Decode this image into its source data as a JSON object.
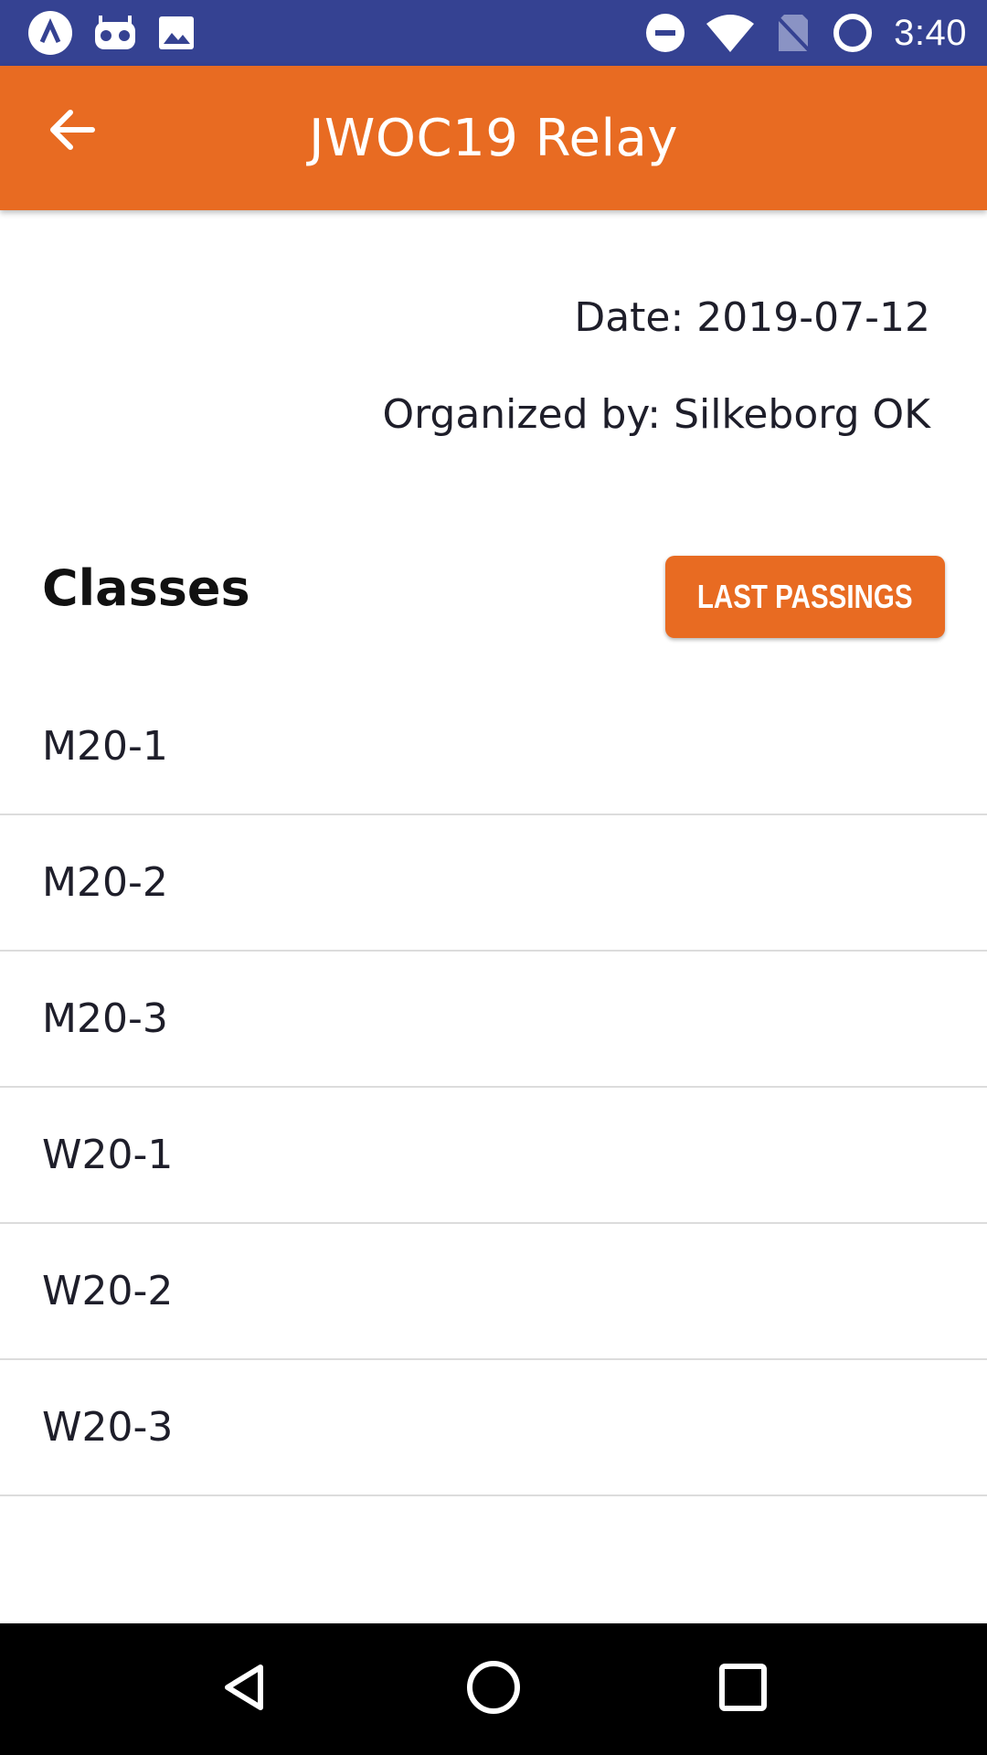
{
  "status_bar": {
    "time": "3:40",
    "left_icons": [
      "app-notification-icon",
      "voicemail-icon",
      "image-icon"
    ],
    "right_icons": [
      "do-not-disturb-icon",
      "wifi-icon",
      "no-sim-icon",
      "battery-icon"
    ],
    "background_color": "#354292"
  },
  "app_bar": {
    "title": "JWOC19 Relay",
    "back_icon": "arrow-left-icon",
    "background_color": "#e86b22"
  },
  "event_info": {
    "date": "Date: 2019-07-12",
    "organizer": "Organized by: Silkeborg OK"
  },
  "classes_section": {
    "heading": "Classes",
    "last_passings_label": "LAST PASSINGS",
    "items": [
      {
        "label": "M20-1"
      },
      {
        "label": "M20-2"
      },
      {
        "label": "M20-3"
      },
      {
        "label": "W20-1"
      },
      {
        "label": "W20-2"
      },
      {
        "label": "W20-3"
      }
    ]
  },
  "nav_bar": {
    "icons": [
      "back-triangle-icon",
      "home-circle-icon",
      "recents-square-icon"
    ]
  }
}
